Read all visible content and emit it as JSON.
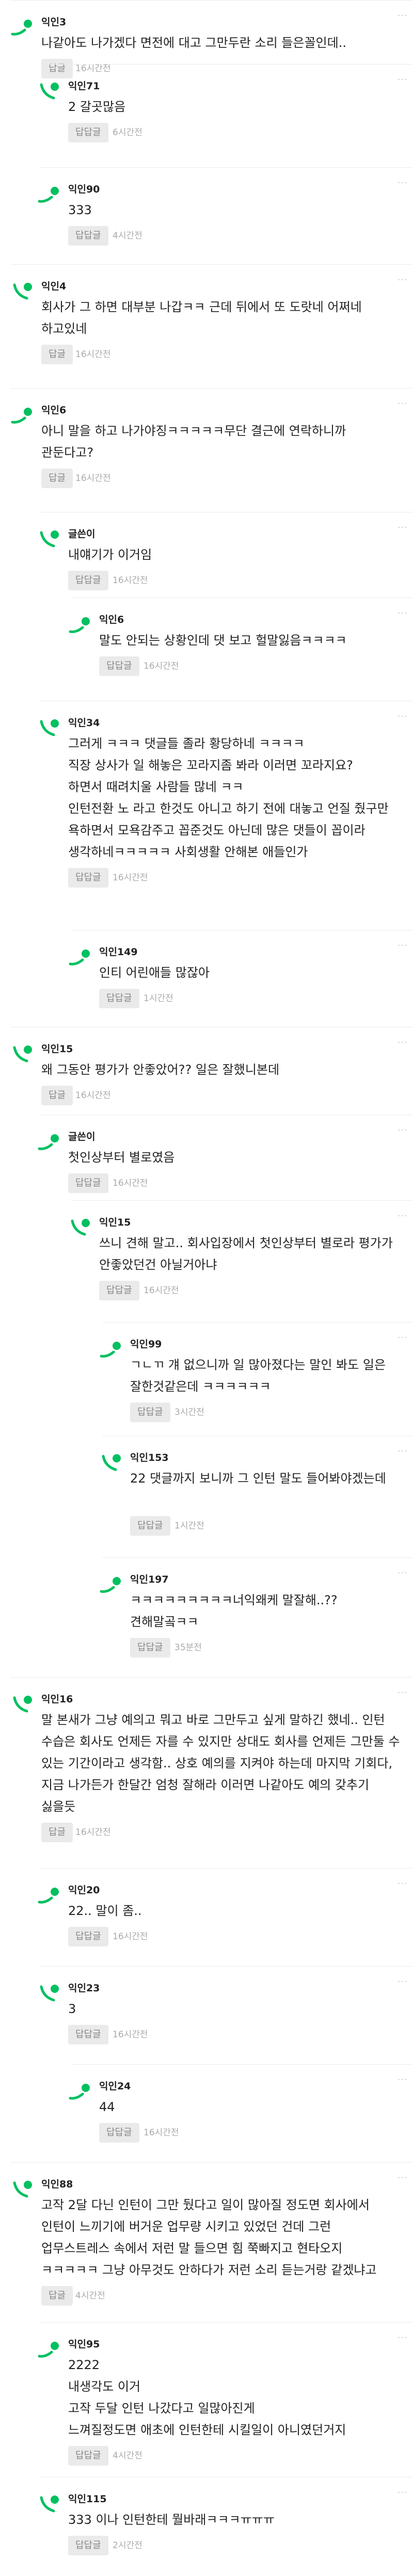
{
  "reply_label": "답글",
  "reply_reply_label": "답답글",
  "colors": {
    "brand_green": "#00c060",
    "bg": "#ffffff",
    "divider": "#ececec",
    "reply_button_bg": "#eaeaea"
  },
  "icons": {
    "avatar": "green-dot-swoosh-avatar-icon",
    "more": "more-dots-icon"
  },
  "comments": [
    {
      "author": "익인3",
      "text": "나같아도 나가겠다 면전에 대고 그만두란 소리 들은꼴인데..",
      "reply": "답글",
      "time": "16시간전",
      "depth": 0
    },
    {
      "author": "익인71",
      "text": "2 갈곳많음",
      "reply": "답답글",
      "time": "6시간전",
      "depth": 1
    },
    {
      "author": "익인90",
      "text": "333",
      "reply": "답답글",
      "time": "4시간전",
      "depth": 1
    },
    {
      "author": "익인4",
      "text": "회사가 그 하면 대부분 나갑ㅋㅋ 근데 뒤에서 또 도랏네 어쩌네 하고있네",
      "reply": "답글",
      "time": "16시간전",
      "depth": 0
    },
    {
      "author": "익인6",
      "text": "아니 말을 하고 나가야징ㅋㅋㅋㅋㅋ무단 결근에 연락하니까 관둔다고?",
      "reply": "답글",
      "time": "16시간전",
      "depth": 0
    },
    {
      "author": "글쓴이",
      "text": "내얘기가 이거임",
      "reply": "답답글",
      "time": "16시간전",
      "depth": 1
    },
    {
      "author": "익인6",
      "text": "말도 안되는 상황인데 댓 보고 헐말잃음ㅋㅋㅋㅋ",
      "reply": "답답글",
      "time": "16시간전",
      "depth": 2
    },
    {
      "author": "익인34",
      "text": "그러게 ㅋㅋㅋ 댓글들 졸라 황당하네 ㅋㅋㅋㅋ\n직장 상사가 일 해놓은 꼬라지좀 봐라 이러면 꼬라지요?\n하면서 때려치울 사람들 많네 ㅋㅋ\n인턴전환 노 라고 한것도 아니고 하기 전에 대놓고 언질 줬구만 욕하면서 모욕감주고 꼽준것도 아닌데 많은 댓들이 꼽이라 생각하네ㅋㅋㅋㅋㅋ 사회생활 안해본 애들인가",
      "reply": "답답글",
      "time": "16시간전",
      "depth": 1
    },
    {
      "author": "익인149",
      "text": "인티 어린애들 많잖아",
      "reply": "답답글",
      "time": "1시간전",
      "depth": 2
    },
    {
      "author": "익인15",
      "text": "왜 그동안 평가가 안좋았어?? 일은 잘했니본데",
      "reply": "답글",
      "time": "16시간전",
      "depth": 0
    },
    {
      "author": "글쓴이",
      "text": "첫인상부터 별로였음",
      "reply": "답답글",
      "time": "16시간전",
      "depth": 1
    },
    {
      "author": "익인15",
      "text": "쓰니 견해 말고.. 회사입장에서 첫인상부터 별로라 평가가 안좋았던건 아닐거아냐",
      "reply": "답답글",
      "time": "16시간전",
      "depth": 2
    },
    {
      "author": "익인99",
      "text": "ㄱㄴㄲ 걔 없으니까 일 많아졌다는 말인 봐도 일은 잘한것같은데 ㅋㅋㅋㅋㅋㅋ",
      "reply": "답답글",
      "time": "3시간전",
      "depth": 3
    },
    {
      "author": "익인153",
      "text": "22 댓글까지 보니까 그 인턴 말도 들어봐야겠는데",
      "reply": "답답글",
      "time": "1시간전",
      "depth": 3
    },
    {
      "author": "익인197",
      "text": "ㅋㅋㅋㅋㅋㅋㅋㅋㅋ너익왜케 말잘해..?? 견해말곸ㅋㅋ",
      "reply": "답답글",
      "time": "35분전",
      "depth": 3
    },
    {
      "author": "익인16",
      "text": "말 본새가 그냥 예의고 뭐고 바로 그만두고 싶게 말하긴 했네.. 인턴 수습은 회사도 언제든 자를 수 있지만 상대도 회사를 언제든 그만둘 수 있는 기간이라고 생각함.. 상호 예의를 지켜야 하는데 마지막 기회다, 지금 나가든가 한달간 엄청 잘해라 이러면 나같아도 예의 갖추기 싫을듯",
      "reply": "답글",
      "time": "16시간전",
      "depth": 0
    },
    {
      "author": "익인20",
      "text": "22.. 말이 좀..",
      "reply": "답답글",
      "time": "16시간전",
      "depth": 1
    },
    {
      "author": "익인23",
      "text": "3",
      "reply": "답답글",
      "time": "16시간전",
      "depth": 1
    },
    {
      "author": "익인24",
      "text": "44",
      "reply": "답답글",
      "time": "16시간전",
      "depth": 2
    },
    {
      "author": "익인88",
      "text": "고작 2달 다닌 인턴이 그만 뒀다고 일이 많아질 정도면 회사에서 인턴이 느끼기에 버거운 업무량 시키고 있었던 건데 그런 업무스트레스 속에서 저런 말 들으면 힘 쭉빠지고 현타오지 ㅋㅋㅋㅋㅋ 그냥 아무것도 안하다가 저런 소리 듣는거랑 같겠냐고",
      "reply": "답글",
      "time": "4시간전",
      "depth": 0
    },
    {
      "author": "익인95",
      "text": "2222\n내생각도 이거\n고작 두달 인턴 나갔다고 일많아진게\n느껴질정도면 애초에 인턴한테 시킬일이 아니였던거지",
      "reply": "답답글",
      "time": "4시간전",
      "depth": 1
    },
    {
      "author": "익인115",
      "text": "333 이나 인턴한테 뭘바래ㅋㅋㅋㅠㅠㅠ",
      "reply": "답답글",
      "time": "2시간전",
      "depth": 1
    }
  ]
}
